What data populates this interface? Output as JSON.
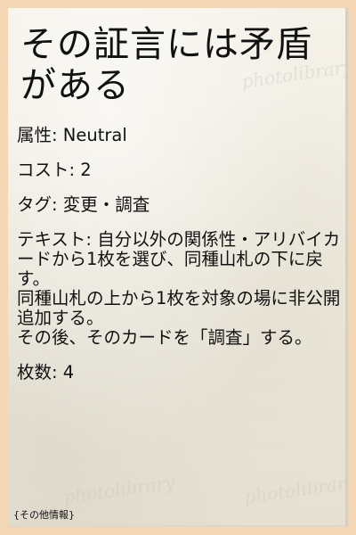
{
  "card": {
    "title": "その証言には矛盾がある",
    "attribute_label": "属性: ",
    "attribute_value": "Neutral",
    "cost_label": "コスト: ",
    "cost_value": "2",
    "tags_label": "タグ: ",
    "tags_value": "変更・調査",
    "text_label": "テキスト: ",
    "text_value": "自分以外の関係性・アリバイカードから1枚を選び、同種山札の下に戻す。\n同種山札の上から1枚を対象の場に非公開追加する。\nその後、そのカードを「調査」する。",
    "count_label": "枚数: ",
    "count_value": "4",
    "footer": "{その他情報}",
    "watermark": "photolibrary"
  }
}
